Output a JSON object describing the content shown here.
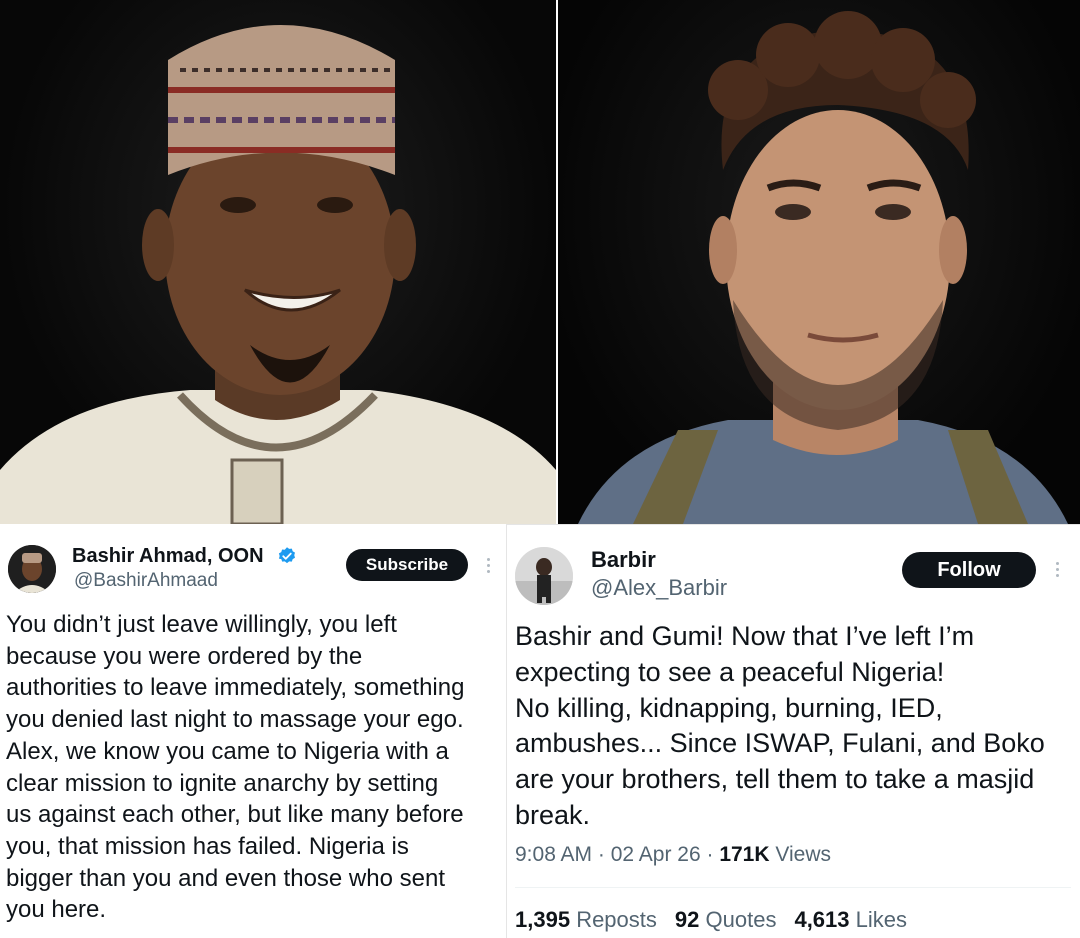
{
  "left_post": {
    "author_name": "Bashir Ahmad, OON",
    "author_handle": "@BashirAhmaad",
    "action_button": "Subscribe",
    "text": "You didn’t just leave willingly, you left\nbecause you were ordered by the\nauthorities to leave immediately, something\nyou denied last night to massage your ego.\nAlex, we know you came to Nigeria with a\nclear mission to ignite anarchy by setting\nus against each other, but like many before\nyou, that mission has failed. Nigeria is\nbigger than you and even those who sent\nyou here.",
    "verified_icon": "verified-badge-icon",
    "verified_color": "#1d9bf0"
  },
  "right_post": {
    "author_name": "Barbir",
    "author_handle": "@Alex_Barbir",
    "action_button": "Follow",
    "text": "Bashir and Gumi! Now that I’ve left I’m\nexpecting to see a peaceful Nigeria!\nNo killing, kidnapping, burning, IED,\nambushes... Since ISWAP, Fulani, and Boko\nare your brothers, tell them to take a masjid\nbreak.",
    "time": "9:08 AM",
    "date": "02 Apr 26",
    "views_count": "171K",
    "views_label": "Views",
    "reposts_count": "1,395",
    "reposts_label": "Reposts",
    "quotes_count": "92",
    "quotes_label": "Quotes",
    "likes_count": "4,613",
    "likes_label": "Likes"
  },
  "colors": {
    "button_bg": "#0f1419",
    "secondary_text": "#536471"
  }
}
